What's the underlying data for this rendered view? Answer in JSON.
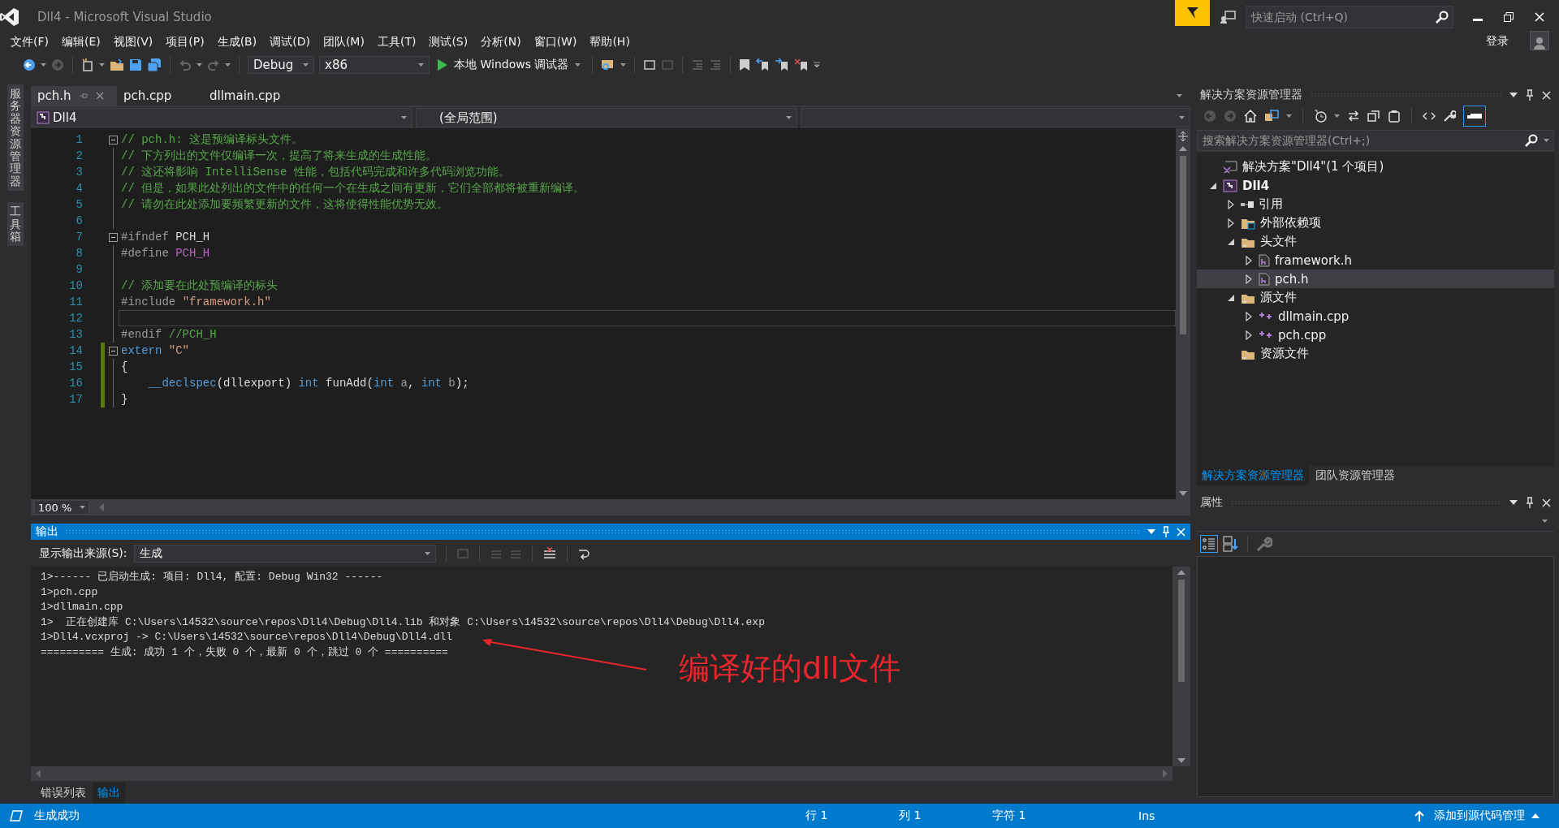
{
  "window": {
    "title": "Dll4 - Microsoft Visual Studio",
    "quick_launch": {
      "placeholder": "快速启动 (Ctrl+Q)"
    },
    "sign_in": "登录"
  },
  "menu": [
    "文件(F)",
    "编辑(E)",
    "视图(V)",
    "项目(P)",
    "生成(B)",
    "调试(D)",
    "团队(M)",
    "工具(T)",
    "测试(S)",
    "分析(N)",
    "窗口(W)",
    "帮助(H)"
  ],
  "toolbar": {
    "configuration": "Debug",
    "platform": "x86",
    "run": "本地 Windows 调试器"
  },
  "side_tabs": [
    "服务器资源管理器",
    "工具箱"
  ],
  "editor": {
    "tabs": [
      {
        "label": "pch.h",
        "selected": true
      },
      {
        "label": "pch.cpp",
        "selected": false
      },
      {
        "label": "dllmain.cpp",
        "selected": false
      }
    ],
    "nav": {
      "project": "Dll4",
      "scope": "(全局范围)"
    },
    "lines": [
      {
        "number": "1",
        "fold": true,
        "changed": false,
        "current": false,
        "tokens": [
          {
            "kind": "comment",
            "text": "// pch.h: 这是预编译标头文件。"
          }
        ]
      },
      {
        "number": "2",
        "fold": false,
        "changed": false,
        "current": false,
        "tokens": [
          {
            "kind": "comment",
            "text": "// 下方列出的文件仅编译一次，提高了将来生成的生成性能。"
          }
        ]
      },
      {
        "number": "3",
        "fold": false,
        "changed": false,
        "current": false,
        "tokens": [
          {
            "kind": "comment",
            "text": "// 这还将影响 IntelliSense 性能，包括代码完成和许多代码浏览功能。"
          }
        ]
      },
      {
        "number": "4",
        "fold": false,
        "changed": false,
        "current": false,
        "tokens": [
          {
            "kind": "comment",
            "text": "// 但是，如果此处列出的文件中的任何一个在生成之间有更新，它们全部都将被重新编译。"
          }
        ]
      },
      {
        "number": "5",
        "fold": false,
        "changed": false,
        "current": false,
        "tokens": [
          {
            "kind": "comment",
            "text": "// 请勿在此处添加要频繁更新的文件，这将使得性能优势无效。"
          }
        ]
      },
      {
        "number": "6",
        "fold": false,
        "changed": false,
        "current": false
      },
      {
        "number": "7",
        "fold": true,
        "changed": false,
        "current": false,
        "tokens": [
          {
            "kind": "preproc",
            "text": "#ifndef "
          },
          {
            "kind": "plain",
            "text": "PCH_H"
          }
        ]
      },
      {
        "number": "8",
        "fold": false,
        "changed": false,
        "current": false,
        "tokens": [
          {
            "kind": "preproc",
            "text": "#define "
          },
          {
            "kind": "macro",
            "text": "PCH_H"
          }
        ]
      },
      {
        "number": "9",
        "fold": false,
        "changed": false,
        "current": false
      },
      {
        "number": "10",
        "fold": false,
        "changed": false,
        "current": false,
        "tokens": [
          {
            "kind": "comment",
            "text": "// 添加要在此处预编译的标头"
          }
        ]
      },
      {
        "number": "11",
        "fold": false,
        "changed": false,
        "current": false,
        "tokens": [
          {
            "kind": "preproc",
            "text": "#include "
          },
          {
            "kind": "string",
            "text": "\"framework.h\""
          }
        ]
      },
      {
        "number": "12",
        "fold": false,
        "changed": false,
        "current": true
      },
      {
        "number": "13",
        "fold": false,
        "changed": false,
        "current": false,
        "tokens": [
          {
            "kind": "preproc",
            "text": "#endif "
          },
          {
            "kind": "comment",
            "text": "//PCH_H"
          }
        ]
      },
      {
        "number": "14",
        "fold": true,
        "changed": true,
        "current": false,
        "tokens": [
          {
            "kind": "keyword",
            "text": "extern "
          },
          {
            "kind": "string",
            "text": "\"C\""
          }
        ]
      },
      {
        "number": "15",
        "fold": false,
        "changed": true,
        "current": false,
        "tokens": [
          {
            "kind": "plain",
            "text": "{"
          }
        ]
      },
      {
        "number": "16",
        "fold": false,
        "changed": true,
        "current": false,
        "tokens": [
          {
            "kind": "keyword",
            "text": "    __declspec"
          },
          {
            "kind": "plain",
            "text": "(dllexport) "
          },
          {
            "kind": "keyword",
            "text": "int"
          },
          {
            "kind": "plain",
            "text": " funAdd("
          },
          {
            "kind": "keyword",
            "text": "int"
          },
          {
            "kind": "param",
            "text": " a"
          },
          {
            "kind": "plain",
            "text": ", "
          },
          {
            "kind": "keyword",
            "text": "int"
          },
          {
            "kind": "param",
            "text": " b"
          },
          {
            "kind": "plain",
            "text": ");"
          }
        ]
      },
      {
        "number": "17",
        "fold": false,
        "changed": true,
        "current": false,
        "tokens": [
          {
            "kind": "plain",
            "text": "}"
          }
        ]
      }
    ],
    "zoom": "100 %"
  },
  "output": {
    "title": "输出",
    "source_label": "显示输出来源(S):",
    "source": "生成",
    "lines": [
      "1>------ 已启动生成: 项目: Dll4, 配置: Debug Win32 ------",
      "1>pch.cpp",
      "1>dllmain.cpp",
      "1>  正在创建库 C:\\Users\\14532\\source\\repos\\Dll4\\Debug\\Dll4.lib 和对象 C:\\Users\\14532\\source\\repos\\Dll4\\Debug\\Dll4.exp",
      "1>Dll4.vcxproj -> C:\\Users\\14532\\source\\repos\\Dll4\\Debug\\Dll4.dll",
      "========== 生成: 成功 1 个，失败 0 个，最新 0 个，跳过 0 个 =========="
    ],
    "annotation": "编译好的dll文件",
    "tabs": [
      {
        "label": "错误列表",
        "selected": false
      },
      {
        "label": "输出",
        "selected": true
      }
    ]
  },
  "solution_explorer": {
    "title": "解决方案资源管理器",
    "search": {
      "placeholder": "搜索解决方案资源管理器(Ctrl+;)"
    },
    "tree": [
      {
        "label": "解决方案\"Dll4\"(1 个项目)",
        "kind": "solution",
        "selected": false
      },
      {
        "label": "Dll4",
        "kind": "project",
        "expanded": true,
        "selected": false,
        "children": [
          {
            "label": "引用",
            "kind": "references",
            "expanded": false,
            "selected": false
          },
          {
            "label": "外部依赖项",
            "kind": "external",
            "expanded": false,
            "selected": false
          },
          {
            "label": "头文件",
            "kind": "filter",
            "expanded": true,
            "selected": false,
            "children": [
              {
                "label": "framework.h",
                "kind": "header",
                "expanded": false,
                "selected": false
              },
              {
                "label": "pch.h",
                "kind": "header",
                "expanded": false,
                "selected": true
              }
            ]
          },
          {
            "label": "源文件",
            "kind": "filter",
            "expanded": true,
            "selected": false,
            "children": [
              {
                "label": "dllmain.cpp",
                "kind": "cpp",
                "expanded": false,
                "selected": false
              },
              {
                "label": "pch.cpp",
                "kind": "cpp",
                "expanded": false,
                "selected": false
              }
            ]
          },
          {
            "label": "资源文件",
            "kind": "filter",
            "selected": false
          }
        ]
      }
    ],
    "tabs": [
      {
        "label": "解决方案资源管理器",
        "selected": true
      },
      {
        "label": "团队资源管理器",
        "selected": false
      }
    ]
  },
  "properties": {
    "title": "属性"
  },
  "status_bar": {
    "message": "生成成功",
    "line": "行 1",
    "column": "列 1",
    "char": "字符 1",
    "mode": "Ins",
    "source_control": "添加到源代码管理"
  }
}
